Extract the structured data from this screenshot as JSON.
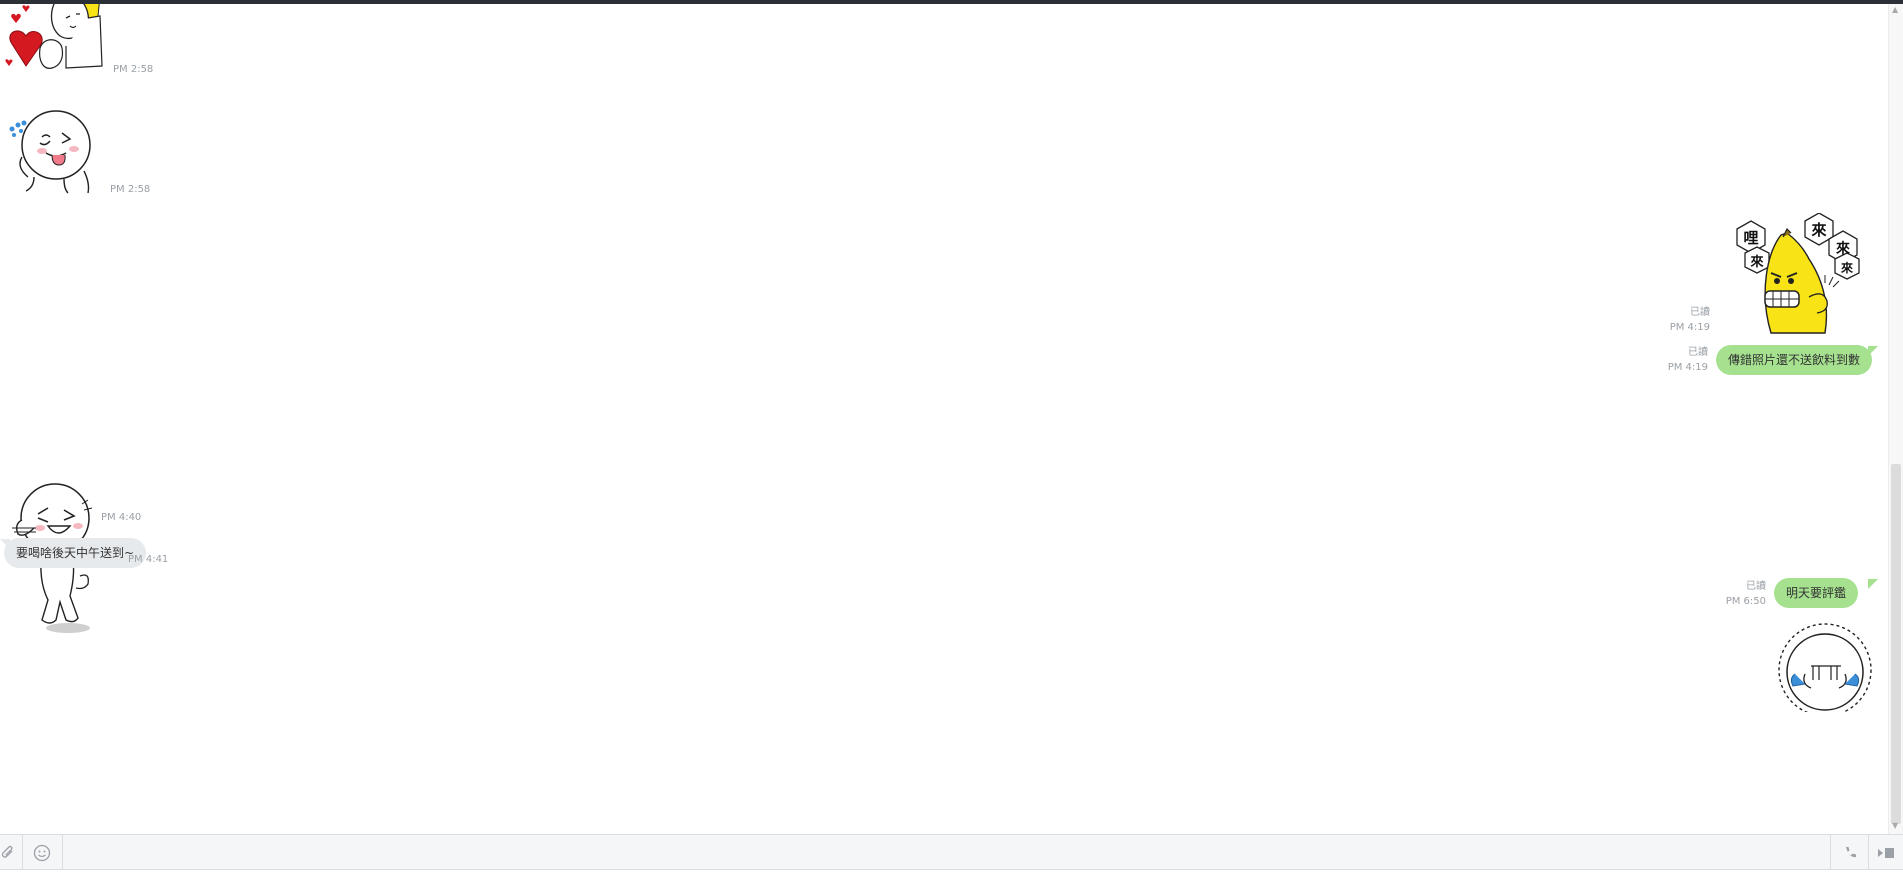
{
  "messages": [
    {
      "id": "m1",
      "side": "received",
      "type": "sticker",
      "sticker": "girl-hearts-sticker",
      "time": "PM 2:58"
    },
    {
      "id": "m2",
      "side": "received",
      "type": "sticker",
      "sticker": "moon-tongue-wink-sticker",
      "time": "PM 2:58"
    },
    {
      "id": "m3",
      "side": "sent",
      "type": "sticker",
      "sticker": "angry-banana-sticker",
      "sticker_text": [
        "哩",
        "來",
        "來",
        "來",
        "來"
      ],
      "read": "已讀",
      "time": "PM 4:19"
    },
    {
      "id": "m4",
      "side": "sent",
      "type": "text",
      "text": "傳錯照片還不送飲料到數",
      "read": "已讀",
      "time": "PM 4:19"
    },
    {
      "id": "m5",
      "side": "received",
      "type": "sticker",
      "sticker": "moon-laughing-sticker",
      "time": "PM 4:40"
    },
    {
      "id": "m6",
      "side": "received",
      "type": "text",
      "text": "要喝啥後天中午送到~",
      "time": "PM 4:41"
    },
    {
      "id": "m7",
      "side": "sent",
      "type": "text",
      "text": "明天要評鑑",
      "read": "已讀",
      "time": "PM 6:50"
    },
    {
      "id": "m8",
      "side": "sent",
      "type": "sticker",
      "sticker": "moon-crying-sticker"
    }
  ],
  "input_bar": {
    "attach_icon": "paperclip-icon",
    "emoji_icon": "smiley-icon",
    "call_icon": "phone-icon",
    "send_icon": "send-icon"
  },
  "colors": {
    "sent_bubble": "#a5e18f",
    "received_bubble": "#e7eaed",
    "timestamp": "#9aa0a6",
    "banana": "#f7e316"
  }
}
